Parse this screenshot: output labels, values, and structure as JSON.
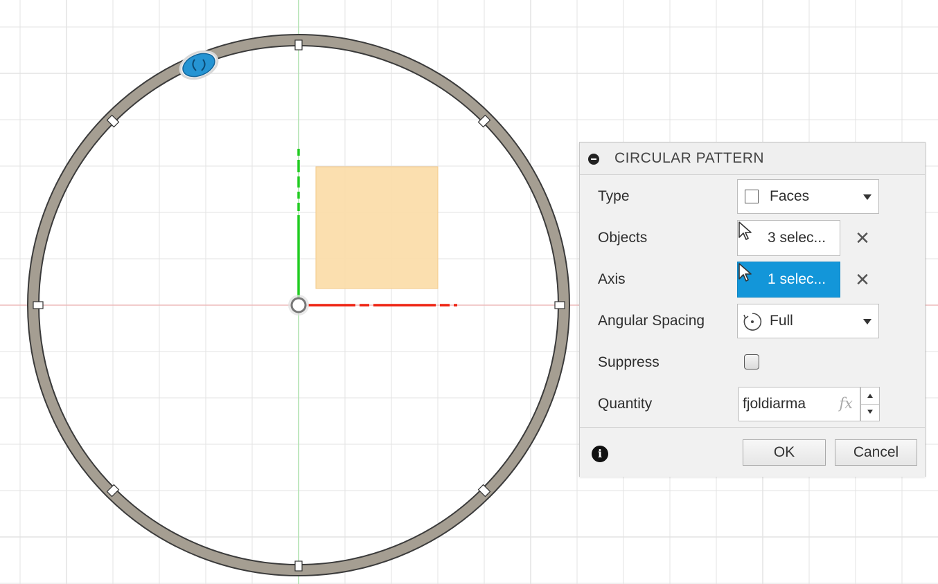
{
  "dialog": {
    "title": "CIRCULAR PATTERN",
    "rows": {
      "type": {
        "label": "Type",
        "value": "Faces",
        "icon": "faces-icon"
      },
      "objects": {
        "label": "Objects",
        "value": "3 selec...",
        "icon": "cursor-icon"
      },
      "axis": {
        "label": "Axis",
        "value": "1 selec...",
        "icon": "cursor-icon",
        "active": true
      },
      "angular_spacing": {
        "label": "Angular Spacing",
        "value": "Full",
        "icon": "rotation-icon"
      },
      "suppress": {
        "label": "Suppress",
        "checked": false
      },
      "quantity": {
        "label": "Quantity",
        "value": "fjoldiarma",
        "fx": "fx"
      }
    },
    "clear_symbol": "✕",
    "info_symbol": "i",
    "buttons": {
      "ok": "OK",
      "cancel": "Cancel"
    }
  },
  "colors": {
    "selection_active": "#1396d9",
    "ring_fill": "#a59e92",
    "face_fill": "#fbdca6",
    "x_axis": "#ee2211",
    "y_axis": "#22cc22",
    "grid": "#e3e3e3"
  }
}
